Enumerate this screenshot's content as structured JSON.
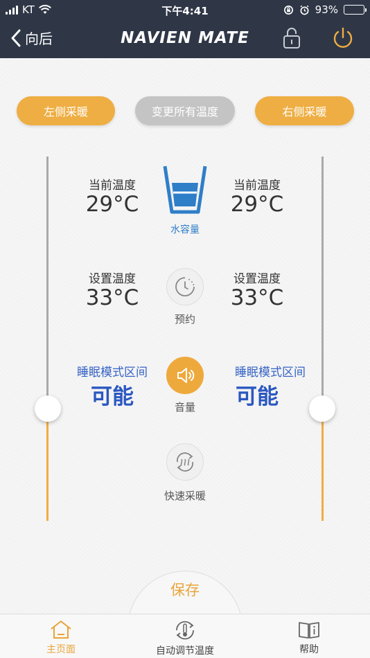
{
  "status_bar": {
    "carrier": "KT",
    "time": "下午4:41",
    "battery_percent": "93%",
    "battery_level": 0.93
  },
  "nav": {
    "back_label": "向后",
    "brand": "NAVIEN MATE"
  },
  "mode_buttons": {
    "left": "左侧采暖",
    "all": "变更所有温度",
    "right": "右侧采暖"
  },
  "left_panel": {
    "current_temp_label": "当前温度",
    "current_temp": "29°C",
    "set_temp_label": "设置温度",
    "set_temp": "33°C",
    "sleep_mode_label": "睡眠模式区间",
    "sleep_mode_value": "可能"
  },
  "right_panel": {
    "current_temp_label": "当前温度",
    "current_temp": "29°C",
    "set_temp_label": "设置温度",
    "set_temp": "33°C",
    "sleep_mode_label": "睡眠模式区间",
    "sleep_mode_value": "可能"
  },
  "center_controls": {
    "water_level_label": "水容量",
    "reservation_label": "预约",
    "volume_label": "音量",
    "quick_heat_label": "快速采暖"
  },
  "save_label": "保存",
  "tabs": [
    {
      "label": "主页面",
      "icon": "home-icon",
      "active": true
    },
    {
      "label": "自动调节温度",
      "icon": "thermo-cycle-icon",
      "active": false
    },
    {
      "label": "帮助",
      "icon": "book-icon",
      "active": false
    }
  ],
  "colors": {
    "header_bg": "#2f3747",
    "accent_orange": "#eeae43",
    "blue_text": "#2b57c0",
    "water_blue": "#2f7ec8"
  }
}
